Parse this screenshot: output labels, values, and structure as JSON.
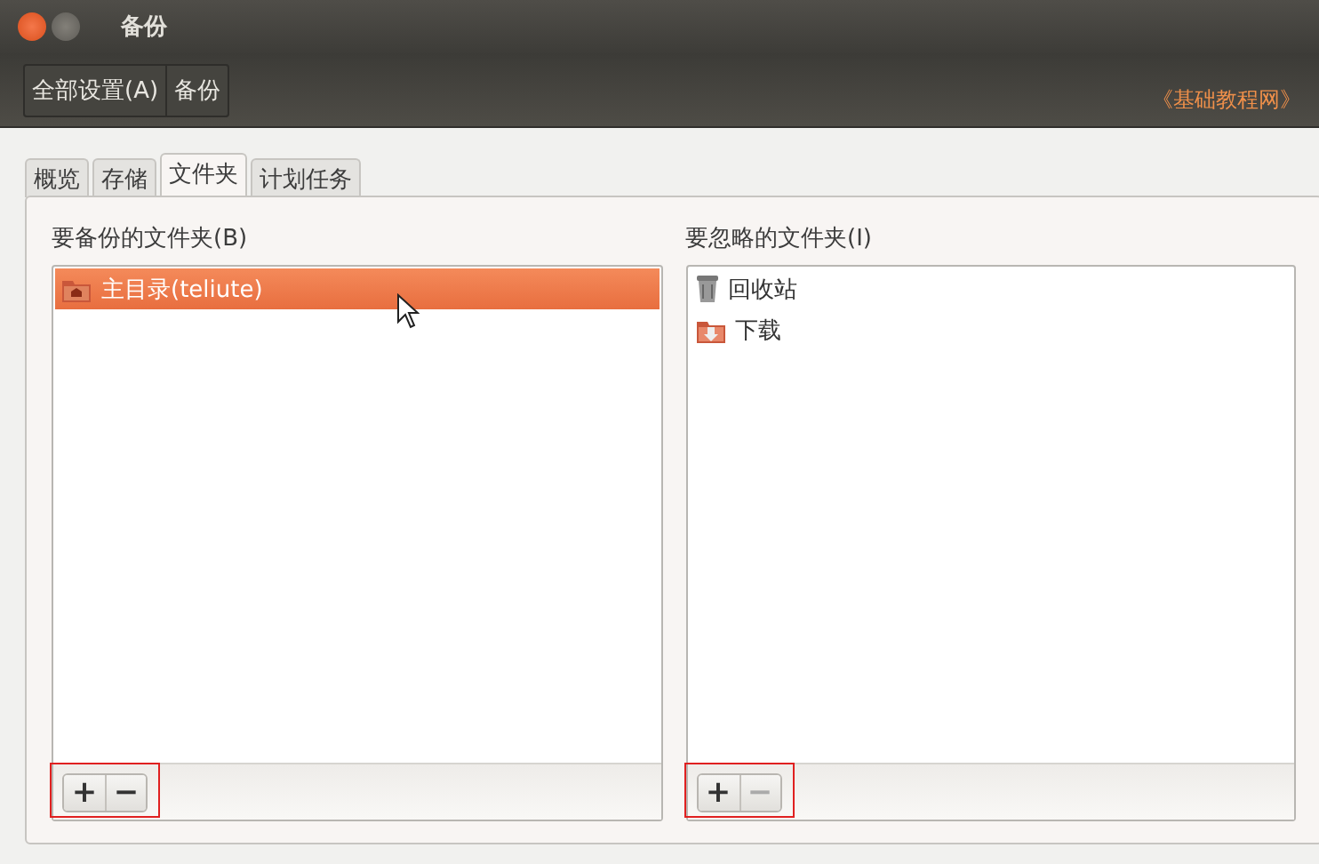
{
  "window": {
    "title": "备份"
  },
  "menu": [
    {
      "label": "全部设置(A)"
    },
    {
      "label": "备份"
    }
  ],
  "watermark_link": "《基础教程网》",
  "tabs": [
    {
      "label": "概览",
      "selected": false
    },
    {
      "label": "存储",
      "selected": false
    },
    {
      "label": "文件夹",
      "selected": true
    },
    {
      "label": "计划任务",
      "selected": false
    }
  ],
  "panes": [
    {
      "title": "要备份的文件夹(B)",
      "highlighted": true,
      "items": [
        {
          "label": "主目录(teliute)",
          "kind": "home",
          "selected": true
        }
      ],
      "add": {
        "label": "+",
        "disabled": false
      },
      "remove": {
        "label": "−",
        "disabled": false
      }
    },
    {
      "title": "要忽略的文件夹(I)",
      "highlighted": true,
      "items": [
        {
          "label": "回收站",
          "kind": "trash",
          "selected": false
        },
        {
          "label": "下载",
          "kind": "download",
          "selected": false
        }
      ],
      "add": {
        "label": "+",
        "disabled": false
      },
      "remove": {
        "label": "−",
        "disabled": true
      }
    }
  ]
}
